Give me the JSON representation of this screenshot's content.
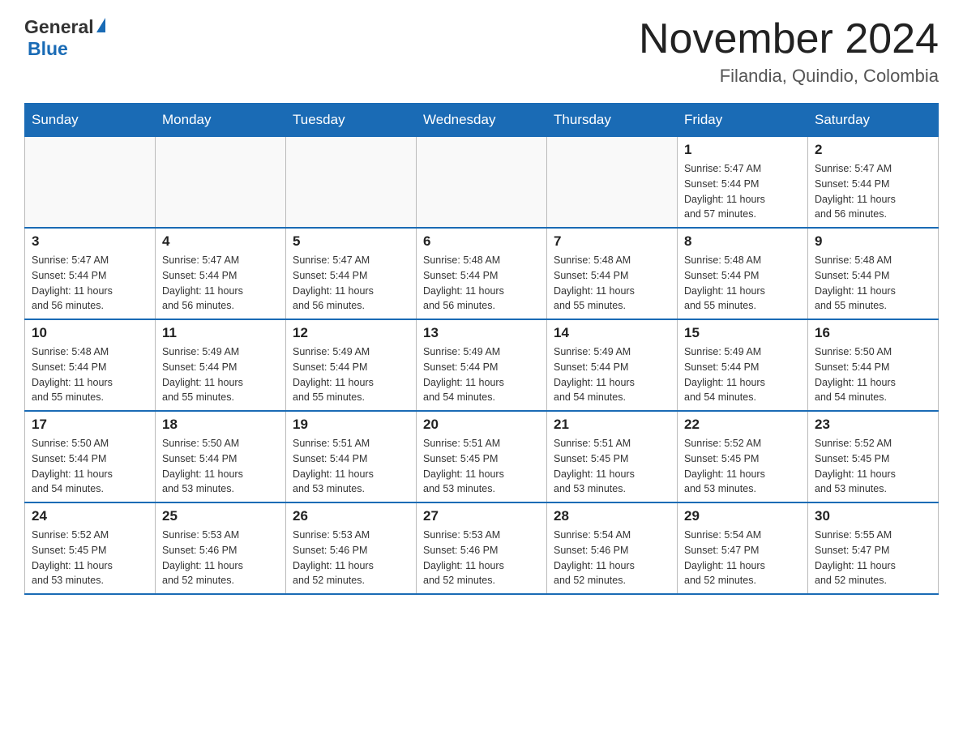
{
  "header": {
    "logo": {
      "general": "General",
      "triangle": "▲",
      "blue": "Blue"
    },
    "title": "November 2024",
    "location": "Filandia, Quindio, Colombia"
  },
  "calendar": {
    "days_of_week": [
      "Sunday",
      "Monday",
      "Tuesday",
      "Wednesday",
      "Thursday",
      "Friday",
      "Saturday"
    ],
    "weeks": [
      {
        "days": [
          {
            "number": "",
            "info": ""
          },
          {
            "number": "",
            "info": ""
          },
          {
            "number": "",
            "info": ""
          },
          {
            "number": "",
            "info": ""
          },
          {
            "number": "",
            "info": ""
          },
          {
            "number": "1",
            "info": "Sunrise: 5:47 AM\nSunset: 5:44 PM\nDaylight: 11 hours\nand 57 minutes."
          },
          {
            "number": "2",
            "info": "Sunrise: 5:47 AM\nSunset: 5:44 PM\nDaylight: 11 hours\nand 56 minutes."
          }
        ]
      },
      {
        "days": [
          {
            "number": "3",
            "info": "Sunrise: 5:47 AM\nSunset: 5:44 PM\nDaylight: 11 hours\nand 56 minutes."
          },
          {
            "number": "4",
            "info": "Sunrise: 5:47 AM\nSunset: 5:44 PM\nDaylight: 11 hours\nand 56 minutes."
          },
          {
            "number": "5",
            "info": "Sunrise: 5:47 AM\nSunset: 5:44 PM\nDaylight: 11 hours\nand 56 minutes."
          },
          {
            "number": "6",
            "info": "Sunrise: 5:48 AM\nSunset: 5:44 PM\nDaylight: 11 hours\nand 56 minutes."
          },
          {
            "number": "7",
            "info": "Sunrise: 5:48 AM\nSunset: 5:44 PM\nDaylight: 11 hours\nand 55 minutes."
          },
          {
            "number": "8",
            "info": "Sunrise: 5:48 AM\nSunset: 5:44 PM\nDaylight: 11 hours\nand 55 minutes."
          },
          {
            "number": "9",
            "info": "Sunrise: 5:48 AM\nSunset: 5:44 PM\nDaylight: 11 hours\nand 55 minutes."
          }
        ]
      },
      {
        "days": [
          {
            "number": "10",
            "info": "Sunrise: 5:48 AM\nSunset: 5:44 PM\nDaylight: 11 hours\nand 55 minutes."
          },
          {
            "number": "11",
            "info": "Sunrise: 5:49 AM\nSunset: 5:44 PM\nDaylight: 11 hours\nand 55 minutes."
          },
          {
            "number": "12",
            "info": "Sunrise: 5:49 AM\nSunset: 5:44 PM\nDaylight: 11 hours\nand 55 minutes."
          },
          {
            "number": "13",
            "info": "Sunrise: 5:49 AM\nSunset: 5:44 PM\nDaylight: 11 hours\nand 54 minutes."
          },
          {
            "number": "14",
            "info": "Sunrise: 5:49 AM\nSunset: 5:44 PM\nDaylight: 11 hours\nand 54 minutes."
          },
          {
            "number": "15",
            "info": "Sunrise: 5:49 AM\nSunset: 5:44 PM\nDaylight: 11 hours\nand 54 minutes."
          },
          {
            "number": "16",
            "info": "Sunrise: 5:50 AM\nSunset: 5:44 PM\nDaylight: 11 hours\nand 54 minutes."
          }
        ]
      },
      {
        "days": [
          {
            "number": "17",
            "info": "Sunrise: 5:50 AM\nSunset: 5:44 PM\nDaylight: 11 hours\nand 54 minutes."
          },
          {
            "number": "18",
            "info": "Sunrise: 5:50 AM\nSunset: 5:44 PM\nDaylight: 11 hours\nand 53 minutes."
          },
          {
            "number": "19",
            "info": "Sunrise: 5:51 AM\nSunset: 5:44 PM\nDaylight: 11 hours\nand 53 minutes."
          },
          {
            "number": "20",
            "info": "Sunrise: 5:51 AM\nSunset: 5:45 PM\nDaylight: 11 hours\nand 53 minutes."
          },
          {
            "number": "21",
            "info": "Sunrise: 5:51 AM\nSunset: 5:45 PM\nDaylight: 11 hours\nand 53 minutes."
          },
          {
            "number": "22",
            "info": "Sunrise: 5:52 AM\nSunset: 5:45 PM\nDaylight: 11 hours\nand 53 minutes."
          },
          {
            "number": "23",
            "info": "Sunrise: 5:52 AM\nSunset: 5:45 PM\nDaylight: 11 hours\nand 53 minutes."
          }
        ]
      },
      {
        "days": [
          {
            "number": "24",
            "info": "Sunrise: 5:52 AM\nSunset: 5:45 PM\nDaylight: 11 hours\nand 53 minutes."
          },
          {
            "number": "25",
            "info": "Sunrise: 5:53 AM\nSunset: 5:46 PM\nDaylight: 11 hours\nand 52 minutes."
          },
          {
            "number": "26",
            "info": "Sunrise: 5:53 AM\nSunset: 5:46 PM\nDaylight: 11 hours\nand 52 minutes."
          },
          {
            "number": "27",
            "info": "Sunrise: 5:53 AM\nSunset: 5:46 PM\nDaylight: 11 hours\nand 52 minutes."
          },
          {
            "number": "28",
            "info": "Sunrise: 5:54 AM\nSunset: 5:46 PM\nDaylight: 11 hours\nand 52 minutes."
          },
          {
            "number": "29",
            "info": "Sunrise: 5:54 AM\nSunset: 5:47 PM\nDaylight: 11 hours\nand 52 minutes."
          },
          {
            "number": "30",
            "info": "Sunrise: 5:55 AM\nSunset: 5:47 PM\nDaylight: 11 hours\nand 52 minutes."
          }
        ]
      }
    ]
  }
}
